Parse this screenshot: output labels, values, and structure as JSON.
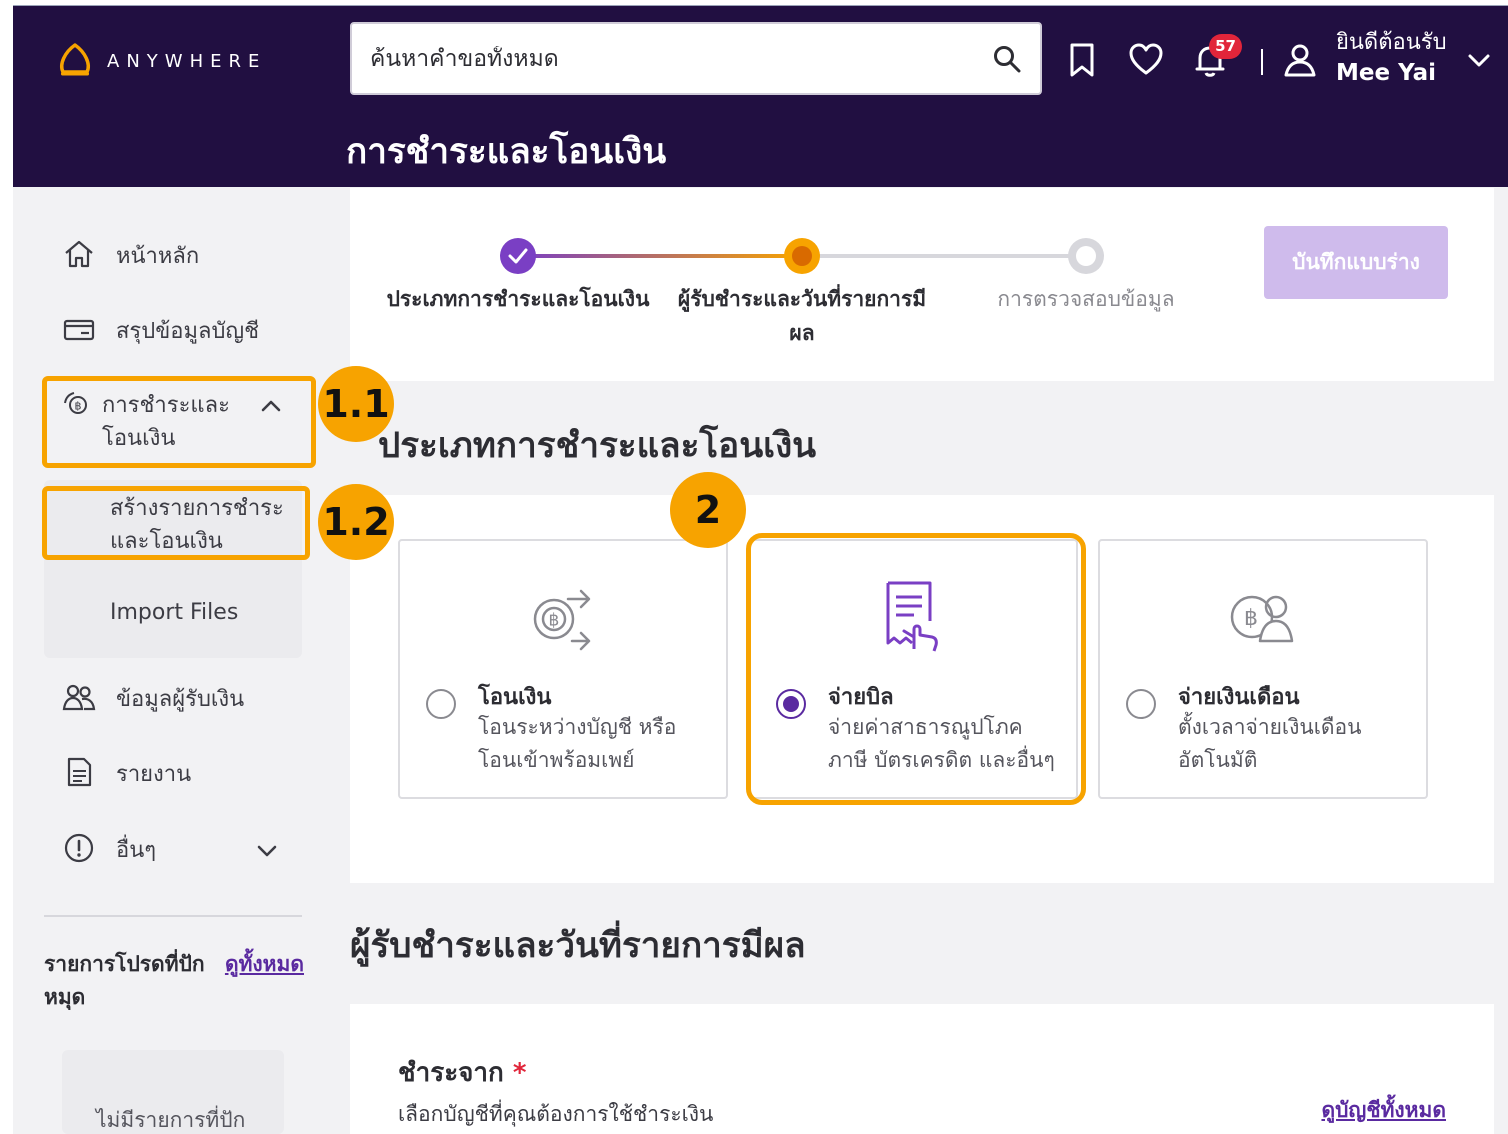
{
  "app": {
    "logo_text": "ANYWHERE"
  },
  "search": {
    "placeholder": "ค้นหาคำขอทั้งหมด"
  },
  "header": {
    "notification_count": "57",
    "welcome": "ยินดีต้อนรับ",
    "user_name": "Mee Yai",
    "page_title": "การชำระและโอนเงิน"
  },
  "sidebar": {
    "home": "หน้าหลัก",
    "account_summary": "สรุปข้อมูลบัญชี",
    "payments_transfer": "การชำระและโอนเงิน",
    "create_payment": "สร้างรายการชำระและโอนเงิน",
    "import_files": "Import Files",
    "payee_info": "ข้อมูลผู้รับเงิน",
    "reports": "รายงาน",
    "others": "อื่นๆ",
    "favorites_title": "รายการโปรดที่ปักหมุด",
    "favorites_view_all": "ดูทั้งหมด",
    "favorites_empty": "ไม่มีรายการที่ปัก"
  },
  "stepper": {
    "steps": [
      {
        "label": "ประเภทการชำระและโอนเงิน",
        "status": "completed"
      },
      {
        "label": "ผู้รับชำระและวันที่รายการมีผล",
        "status": "current"
      },
      {
        "label": "การตรวจสอบข้อมูล",
        "status": "pending"
      }
    ],
    "draft_button": "บันทึกแบบร่าง"
  },
  "payment_type": {
    "section_title": "ประเภทการชำระและโอนเงิน",
    "options": [
      {
        "name": "โอนเงิน",
        "description": "โอนระหว่างบัญชี หรือ โอนเข้าพร้อมเพย์",
        "icon": "baht-transfer-icon",
        "selected": false
      },
      {
        "name": "จ่ายบิล",
        "description": "จ่ายค่าสาธารณูปโภค ภาษี บัตรเครดิต และอื่นๆ",
        "icon": "bill-icon",
        "selected": true
      },
      {
        "name": "จ่ายเงินเดือน",
        "description": "ตั้งเวลาจ่ายเงินเดือน อัตโนมัติ",
        "icon": "payroll-icon",
        "selected": false
      }
    ]
  },
  "payee_section": {
    "section_title": "ผู้รับชำระและวันที่รายการมีผล",
    "source_label": "ชำระจาก",
    "required_mark": "*",
    "source_hint": "เลือกบัญชีที่คุณต้องการใช้ชำระเงิน",
    "view_all_accounts": "ดูบัญชีทั้งหมด"
  },
  "annotations": {
    "callout_1": "1.1",
    "callout_2": "1.2",
    "callout_3": "2"
  },
  "colors": {
    "header_bg": "#210f41",
    "accent": "#5a2aa0",
    "callout": "#f7a300",
    "current_step": "#d96a00",
    "badge": "#e1253a"
  }
}
